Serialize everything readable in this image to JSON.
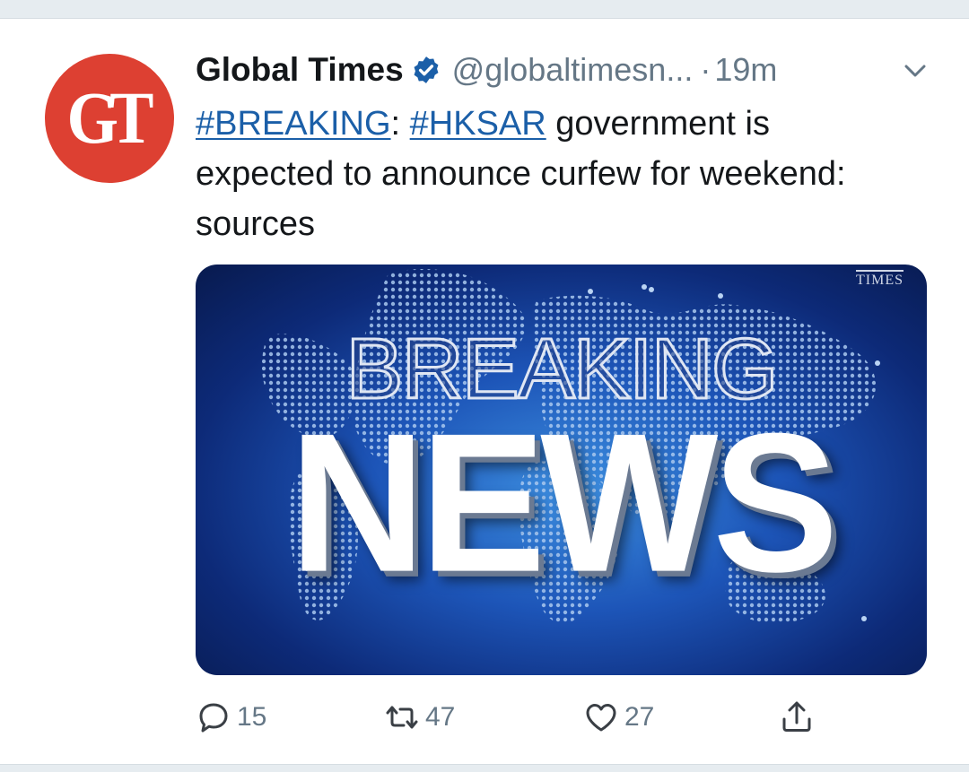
{
  "tweet": {
    "avatar_text": "GT",
    "author_name": "Global Times",
    "handle": "@globaltimesn...",
    "separator": "·",
    "time": "19m",
    "text_parts": {
      "hashtag1": "#BREAKING",
      "colon": ": ",
      "hashtag2": "#HKSAR",
      "body": " government is expected to announce curfew for weekend: sources"
    },
    "media": {
      "watermark": "TIMES",
      "headline_top": "BREAKING",
      "headline_main": "NEWS"
    },
    "actions": {
      "reply_count": "15",
      "retweet_count": "47",
      "like_count": "27"
    }
  },
  "colors": {
    "avatar_bg": "#dd4032",
    "link": "#1b5fa8",
    "muted": "#657786",
    "verified": "#1da1f2"
  },
  "icons": [
    "verified-badge-icon",
    "chevron-down-icon",
    "reply-icon",
    "retweet-icon",
    "like-icon",
    "share-icon"
  ]
}
